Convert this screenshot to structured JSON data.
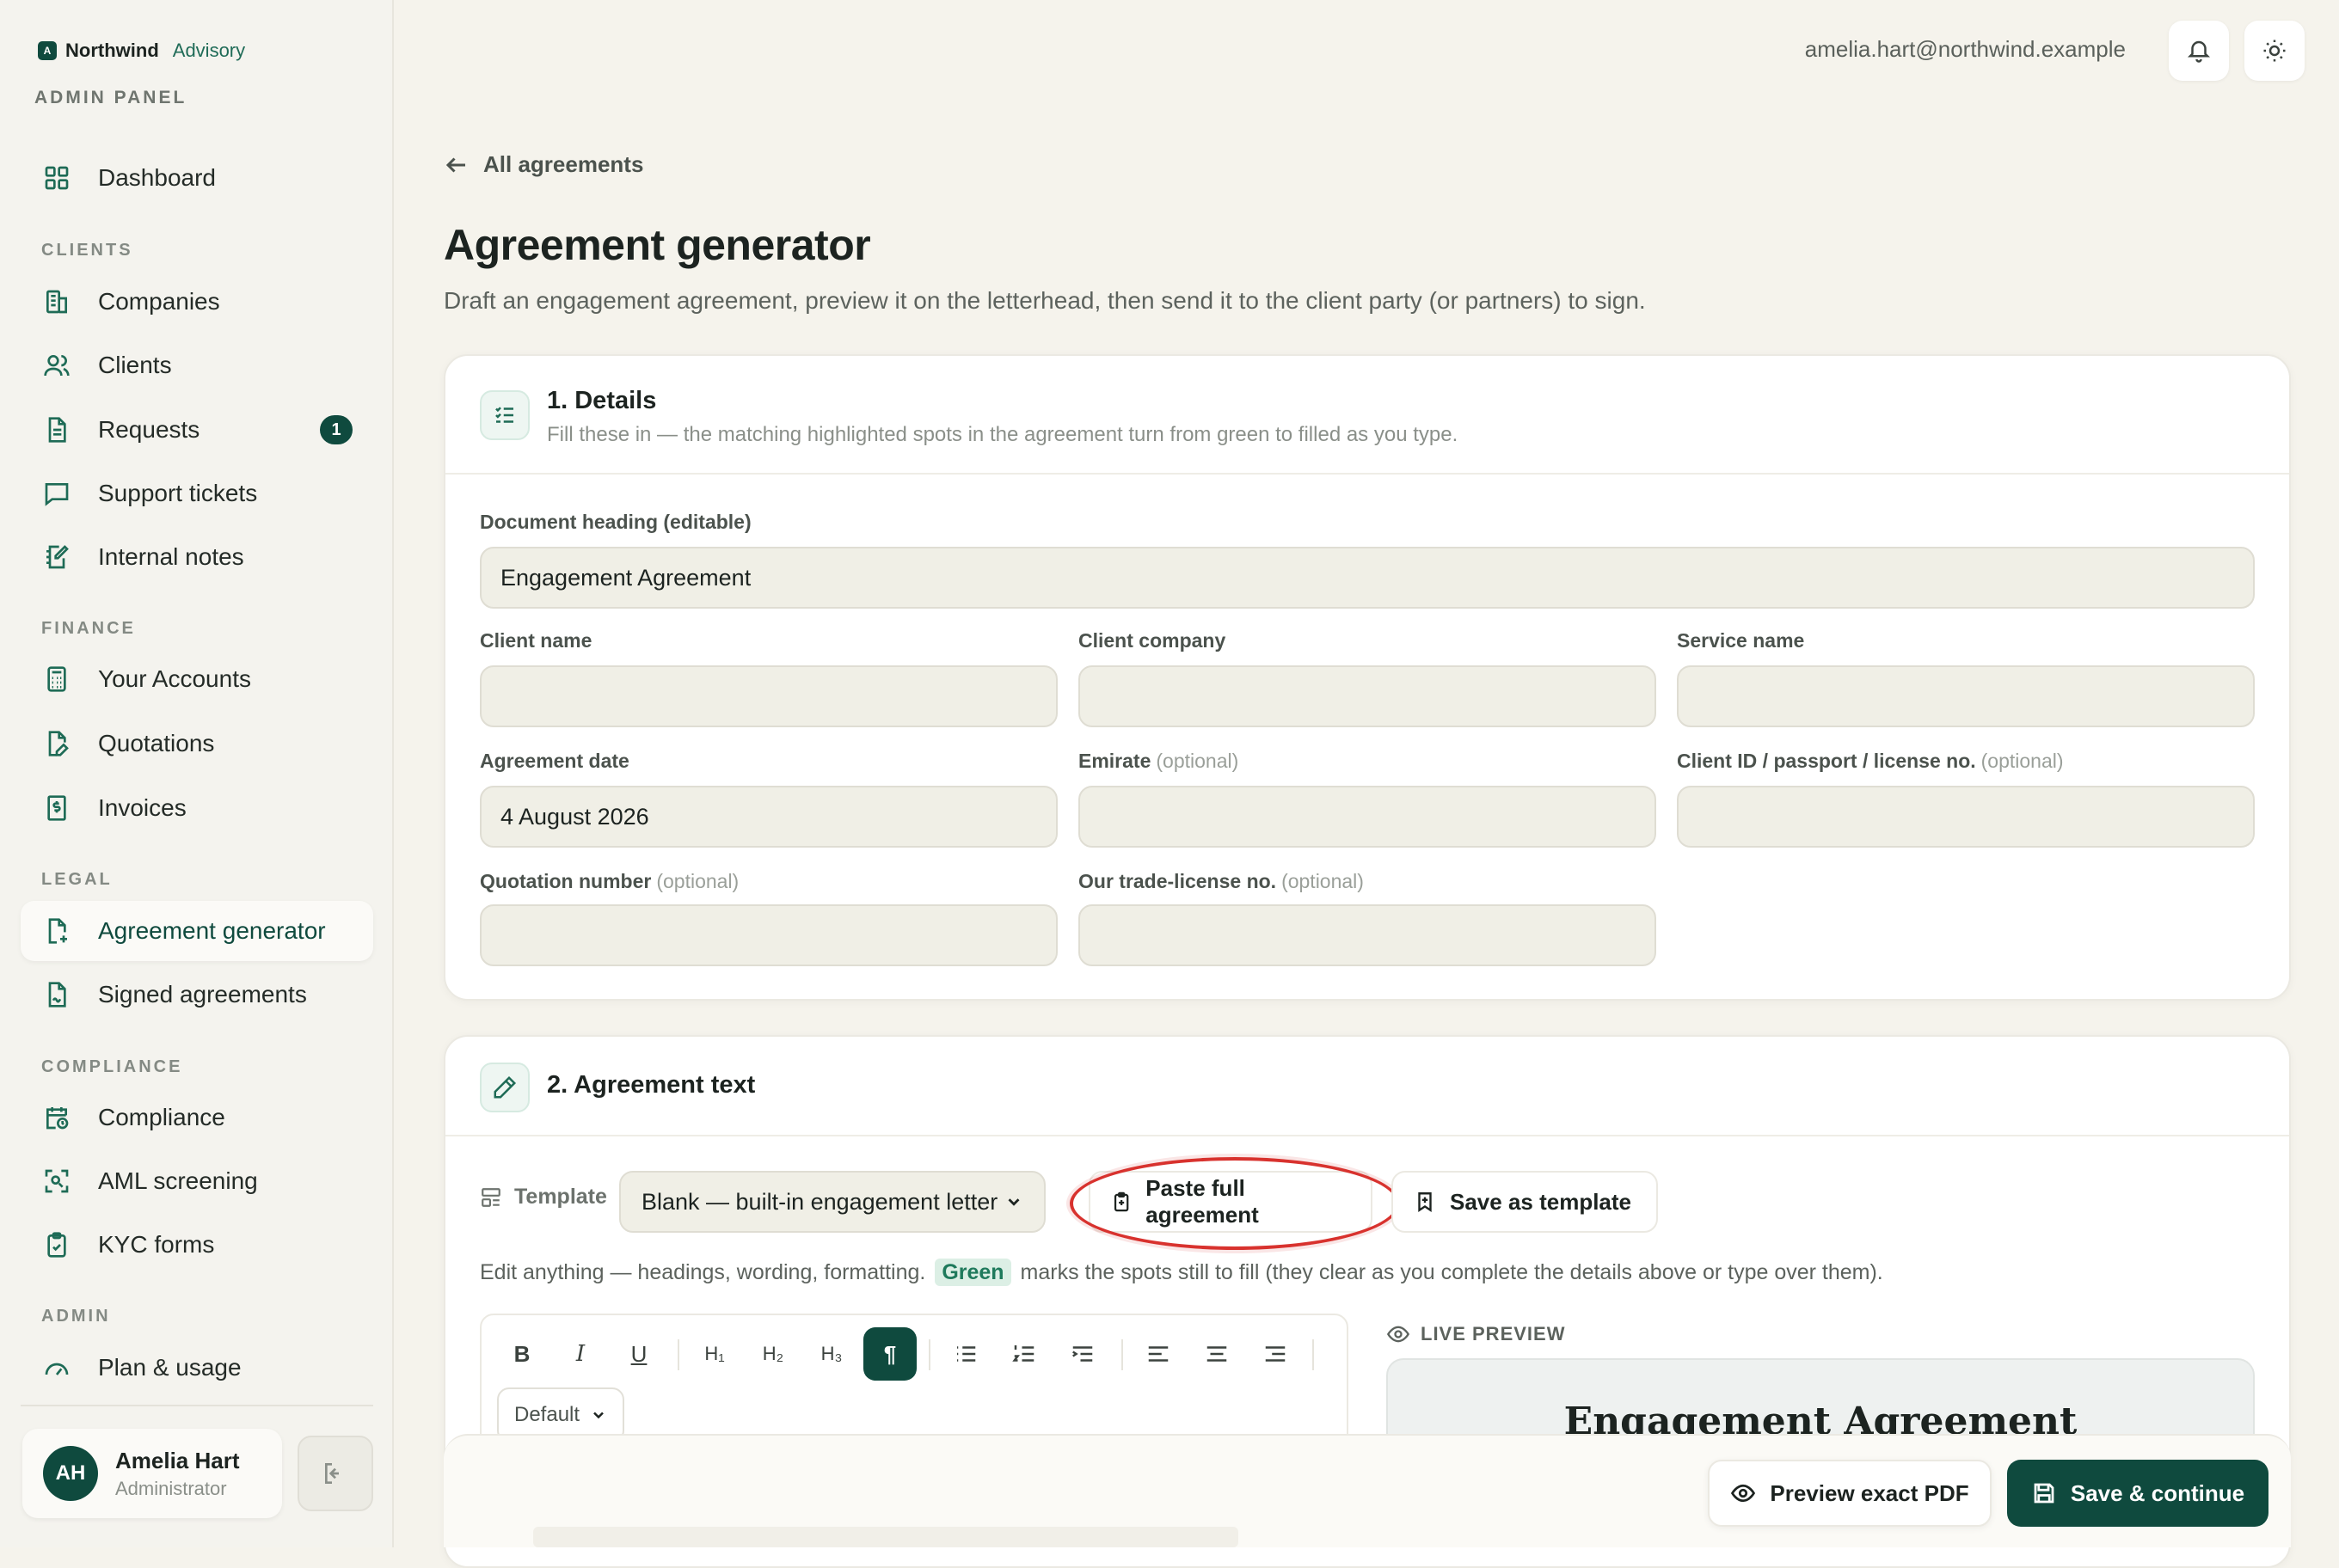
{
  "brand": {
    "logo_letter": "A",
    "name": "Northwind",
    "sub": "Advisory",
    "panel_label": "ADMIN PANEL"
  },
  "sidebar": {
    "dashboard": "Dashboard",
    "sections": {
      "clients": "CLIENTS",
      "finance": "FINANCE",
      "legal": "LEGAL",
      "compliance": "COMPLIANCE",
      "admin": "ADMIN"
    },
    "items": {
      "companies": "Companies",
      "clients": "Clients",
      "requests": "Requests",
      "requests_badge": "1",
      "support_tickets": "Support tickets",
      "internal_notes": "Internal notes",
      "your_accounts": "Your Accounts",
      "quotations": "Quotations",
      "invoices": "Invoices",
      "agreement_generator": "Agreement generator",
      "signed_agreements": "Signed agreements",
      "compliance": "Compliance",
      "aml_screening": "AML screening",
      "kyc_forms": "KYC forms",
      "plan_usage": "Plan & usage"
    },
    "user": {
      "initials": "AH",
      "name": "Amelia Hart",
      "role": "Administrator"
    }
  },
  "topbar": {
    "email": "amelia.hart@northwind.example"
  },
  "main": {
    "back_link": "All agreements",
    "title": "Agreement generator",
    "subtitle": "Draft an engagement agreement, preview it on the letterhead, then send it to the client party (or partners) to sign."
  },
  "details": {
    "title": "1. Details",
    "desc": "Fill these in — the matching highlighted spots in the agreement turn from green to filled as you type.",
    "doc_heading_label": "Document heading (editable)",
    "doc_heading_value": "Engagement Agreement",
    "client_name_label": "Client name",
    "client_name_value": "",
    "client_company_label": "Client company",
    "client_company_value": "",
    "service_name_label": "Service name",
    "service_name_value": "",
    "agreement_date_label": "Agreement date",
    "agreement_date_value": "4 August 2026",
    "emirate_label": "Emirate",
    "emirate_value": "",
    "client_id_label": "Client ID / passport / license no.",
    "client_id_value": "",
    "quotation_label": "Quotation number",
    "quotation_value": "",
    "trade_license_label": "Our trade-license no.",
    "trade_license_value": "",
    "optional": "(optional)"
  },
  "agreement_text": {
    "title": "2. Agreement text",
    "template_label": "Template",
    "template_selected": "Blank — built-in engagement letter",
    "paste_button": "Paste full agreement",
    "save_template_button": "Save as template",
    "help_before": "Edit anything — headings, wording, formatting.",
    "help_green": "Green",
    "help_after": "marks the spots still to fill (they clear as you complete the details above or type over them).",
    "toolbar": {
      "bold": "B",
      "italic": "I",
      "underline": "U",
      "h1": "H₁",
      "h2": "H₂",
      "h3": "H₃",
      "paragraph": "¶"
    },
    "font_select": "Default",
    "live_preview_label": "LIVE PREVIEW",
    "preview_heading": "Engagement Agreement"
  },
  "footer": {
    "preview_pdf": "Preview exact PDF",
    "save_continue": "Save & continue"
  },
  "colors": {
    "accent": "#0f4a3e",
    "highlight_ring": "#d8322e",
    "green_chip": "#dcefe5"
  }
}
